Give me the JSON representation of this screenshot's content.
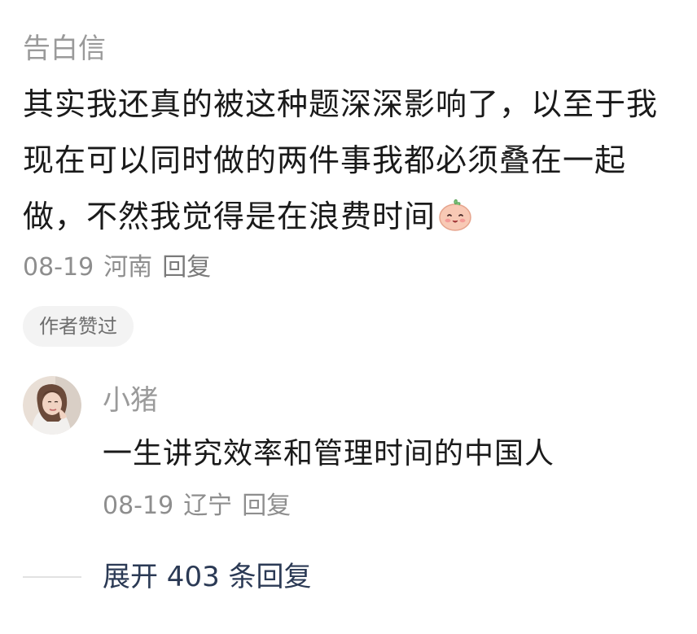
{
  "comment": {
    "username": "告白信",
    "content": "其实我还真的被这种题深深影响了，以至于我现在可以同时做的两件事我都必须叠在一起做，不然我觉得是在浪费时间",
    "emoji": "smiling-face-emoji",
    "date": "08-19",
    "location": "河南",
    "reply_label": "回复"
  },
  "author_liked_label": "作者赞过",
  "reply": {
    "username": "小猪",
    "content": "一生讲究效率和管理时间的中国人",
    "date": "08-19",
    "location": "辽宁",
    "reply_label": "回复",
    "avatar": "user-avatar-photo"
  },
  "expand": {
    "label": "展开 403 条回复"
  },
  "colors": {
    "primary_text": "#1a1a1a",
    "secondary_text": "#9a9a9a",
    "meta_text": "#8e8e8e",
    "expand_text": "#2b3a55",
    "pill_bg": "#f3f3f3"
  }
}
